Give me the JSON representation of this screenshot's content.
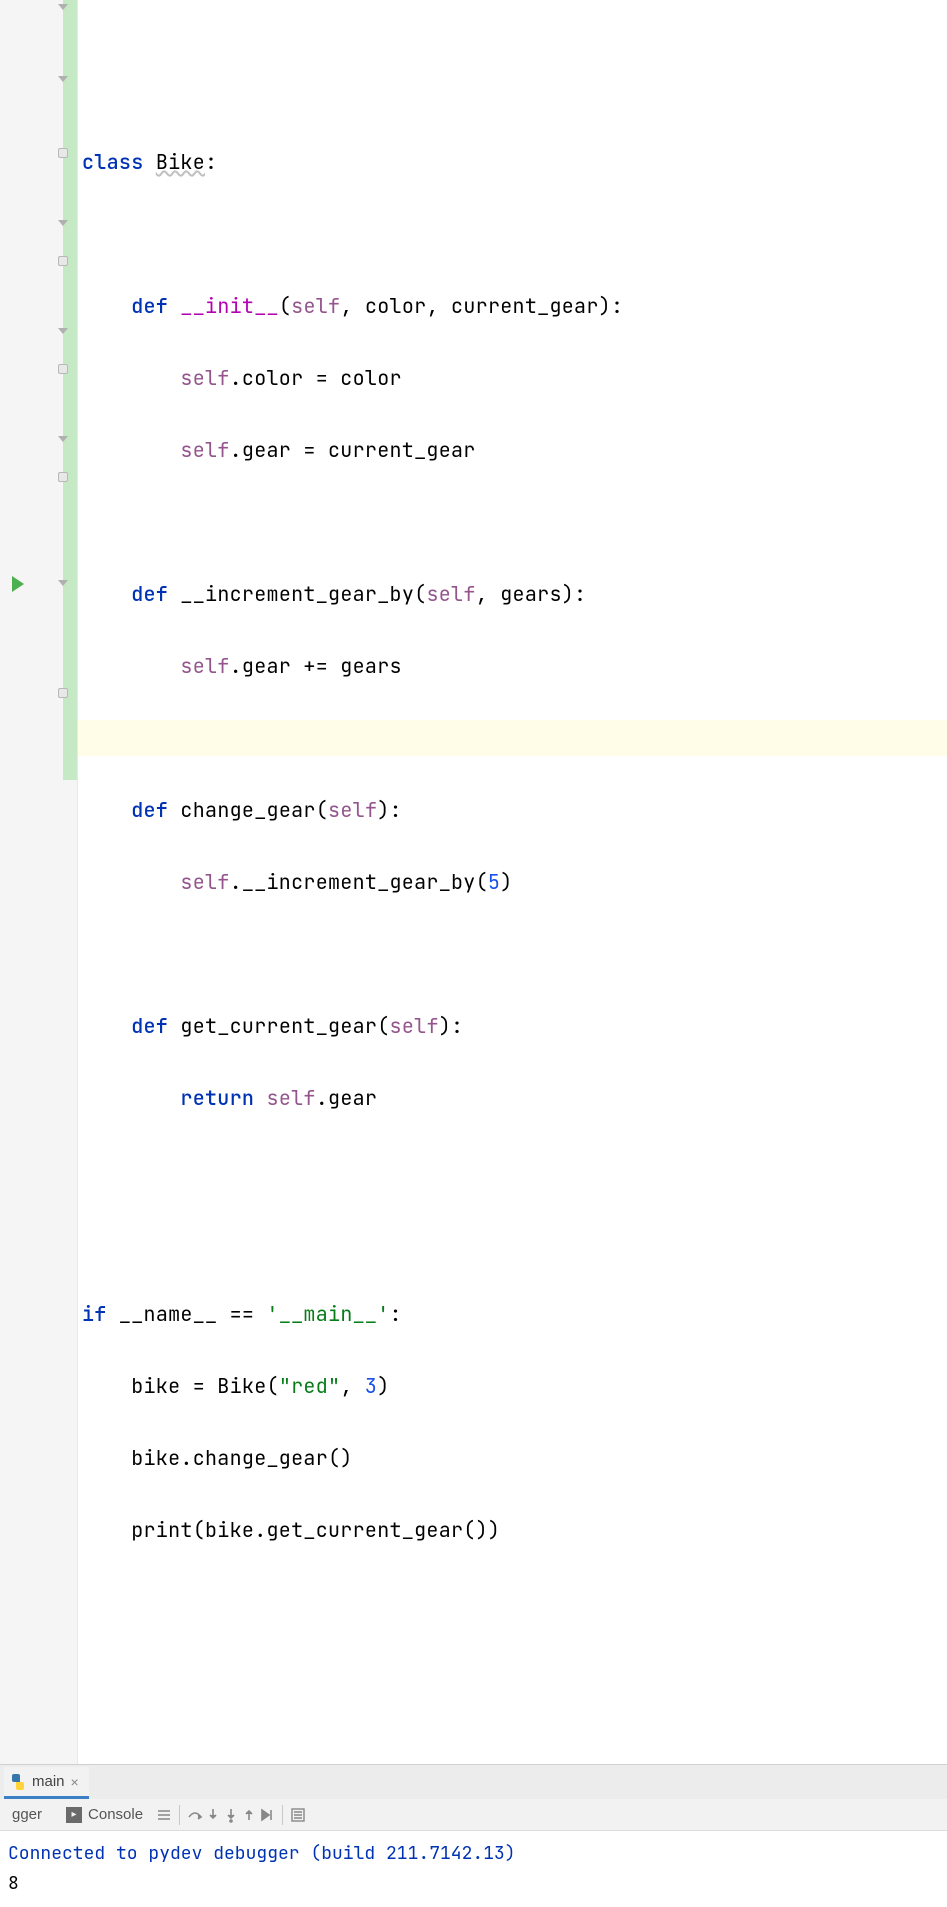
{
  "code": {
    "class_kw": "class",
    "class_name": "Bike",
    "def_kw": "def",
    "init": "__init__",
    "self": "self",
    "init_params": ", color, current_gear):",
    "init_l1_a": ".color = color",
    "init_l2_a": ".gear = current_gear",
    "inc_name": "__increment_gear_by",
    "inc_params": ", gears):",
    "inc_body": ".gear += gears",
    "chg_name": "change_gear",
    "chg_params": "):",
    "chg_body_a": ".__increment_gear_by(",
    "chg_num": "5",
    "chg_body_b": ")",
    "get_name": "get_current_gear",
    "get_params": "):",
    "return_kw": "return",
    "get_body": ".gear",
    "if_kw": "if",
    "name_dunder": "__name__",
    "eq": " == ",
    "main_str": "'__main__'",
    "main_colon": ":",
    "m1_a": "bike = Bike(",
    "m1_str": "\"red\"",
    "m1_b": ", ",
    "m1_num": "3",
    "m1_c": ")",
    "m2": "bike.change_gear()",
    "m3_a": "print",
    "m3_b": "(bike.get_current_gear())"
  },
  "panel": {
    "tab_name": "main",
    "debugger_tab": "gger",
    "console_tab": "Console",
    "output_line1": "Connected to pydev debugger (build 211.7142.13)",
    "output_line2": "8"
  }
}
